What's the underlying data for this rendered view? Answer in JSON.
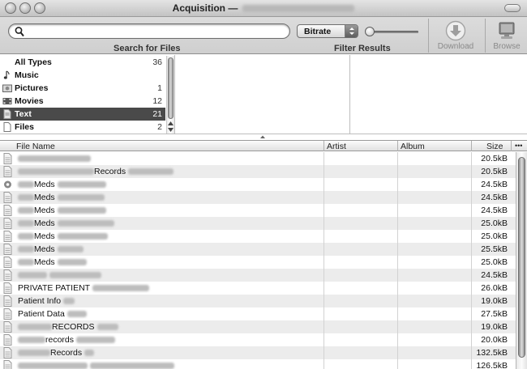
{
  "window": {
    "title": "Acquisition —"
  },
  "toolbar": {
    "search": {
      "value": "",
      "placeholder": ""
    },
    "search_label": "Search for Files",
    "filter_select": "Bitrate",
    "filter_label": "Filter Results",
    "download_label": "Download",
    "browse_label": "Browse"
  },
  "types": [
    {
      "label": "All Types",
      "count": "36",
      "icon": "none"
    },
    {
      "label": "Music",
      "count": "",
      "icon": "music-note-icon"
    },
    {
      "label": "Pictures",
      "count": "1",
      "icon": "picture-icon"
    },
    {
      "label": "Movies",
      "count": "12",
      "icon": "film-icon"
    },
    {
      "label": "Text",
      "count": "21",
      "icon": "text-document-icon",
      "selected": true
    },
    {
      "label": "Files",
      "count": "2",
      "icon": "file-icon"
    }
  ],
  "table": {
    "columns": [
      "File Name",
      "Artist",
      "Album",
      "Size"
    ],
    "more_columns": "•••",
    "rows": [
      {
        "pre": "",
        "text": "",
        "size": "20.5kB"
      },
      {
        "pre": "",
        "text": "Records",
        "size": "20.5kB"
      },
      {
        "pre": "",
        "text": "Meds",
        "size": "24.5kB"
      },
      {
        "pre": "",
        "text": "Meds",
        "size": "24.5kB"
      },
      {
        "pre": "",
        "text": "Meds",
        "size": "24.5kB"
      },
      {
        "pre": "",
        "text": "Meds",
        "size": "25.0kB"
      },
      {
        "pre": "",
        "text": "Meds",
        "size": "25.0kB"
      },
      {
        "pre": "",
        "text": "Meds",
        "size": "25.5kB"
      },
      {
        "pre": "",
        "text": "Meds",
        "size": "25.0kB"
      },
      {
        "pre": "",
        "text": "",
        "size": "24.5kB"
      },
      {
        "pre": "PRIVATE PATIENT",
        "text": "",
        "size": "26.0kB"
      },
      {
        "pre": "Patient Info",
        "text": "",
        "size": "19.0kB"
      },
      {
        "pre": "Patient Data",
        "text": "",
        "size": "27.5kB"
      },
      {
        "pre": "",
        "text": "RECORDS",
        "size": "19.0kB"
      },
      {
        "pre": "",
        "text": "records",
        "size": "20.0kB"
      },
      {
        "pre": "",
        "text": "Records",
        "size": "132.5kB"
      },
      {
        "pre": "",
        "text": "",
        "size": "126.5kB"
      }
    ]
  }
}
